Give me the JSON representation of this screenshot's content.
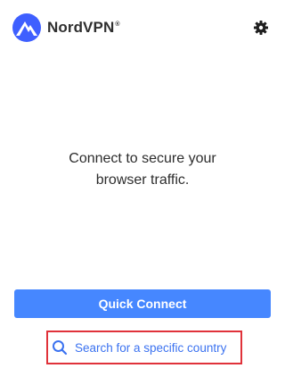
{
  "app": {
    "name": "NordVPN",
    "trademark": "®",
    "accent_color": "#4687ff",
    "logo_color": "#3e5fff"
  },
  "header": {
    "settings_icon": "gear-icon"
  },
  "main": {
    "message_line1": "Connect to secure your",
    "message_line2": "browser traffic."
  },
  "actions": {
    "quick_connect_label": "Quick Connect",
    "search_label": "Search for a specific country",
    "search_icon": "search-icon",
    "highlight_color": "#e0323a"
  }
}
